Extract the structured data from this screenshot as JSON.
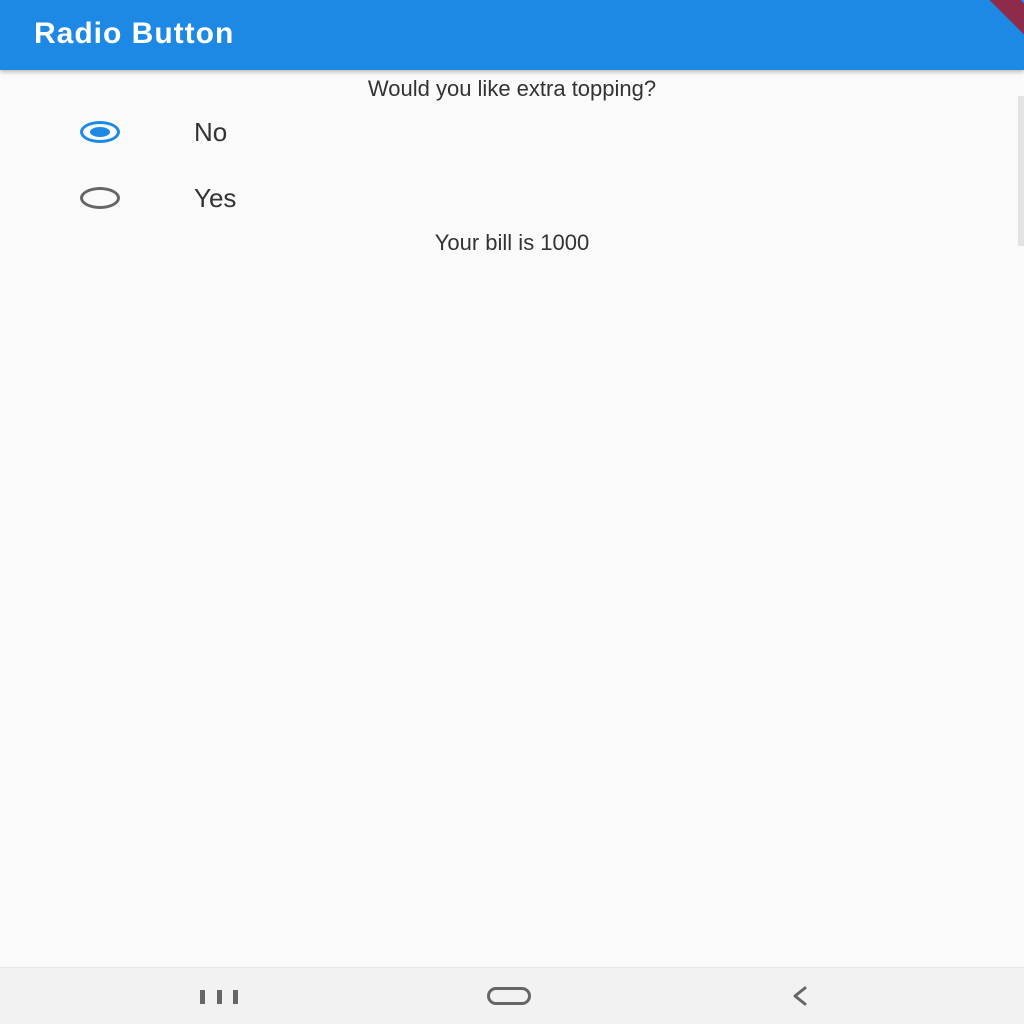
{
  "app_bar": {
    "title": "Radio Button",
    "color": "#1e88e5"
  },
  "question": "Would you like extra topping?",
  "options": [
    {
      "label": "No",
      "selected": true
    },
    {
      "label": "Yes",
      "selected": false
    }
  ],
  "bill_text": "Your bill is 1000",
  "navigation": {
    "recents_icon": "recents-icon",
    "home_icon": "home-icon",
    "back_icon": "back-icon"
  }
}
